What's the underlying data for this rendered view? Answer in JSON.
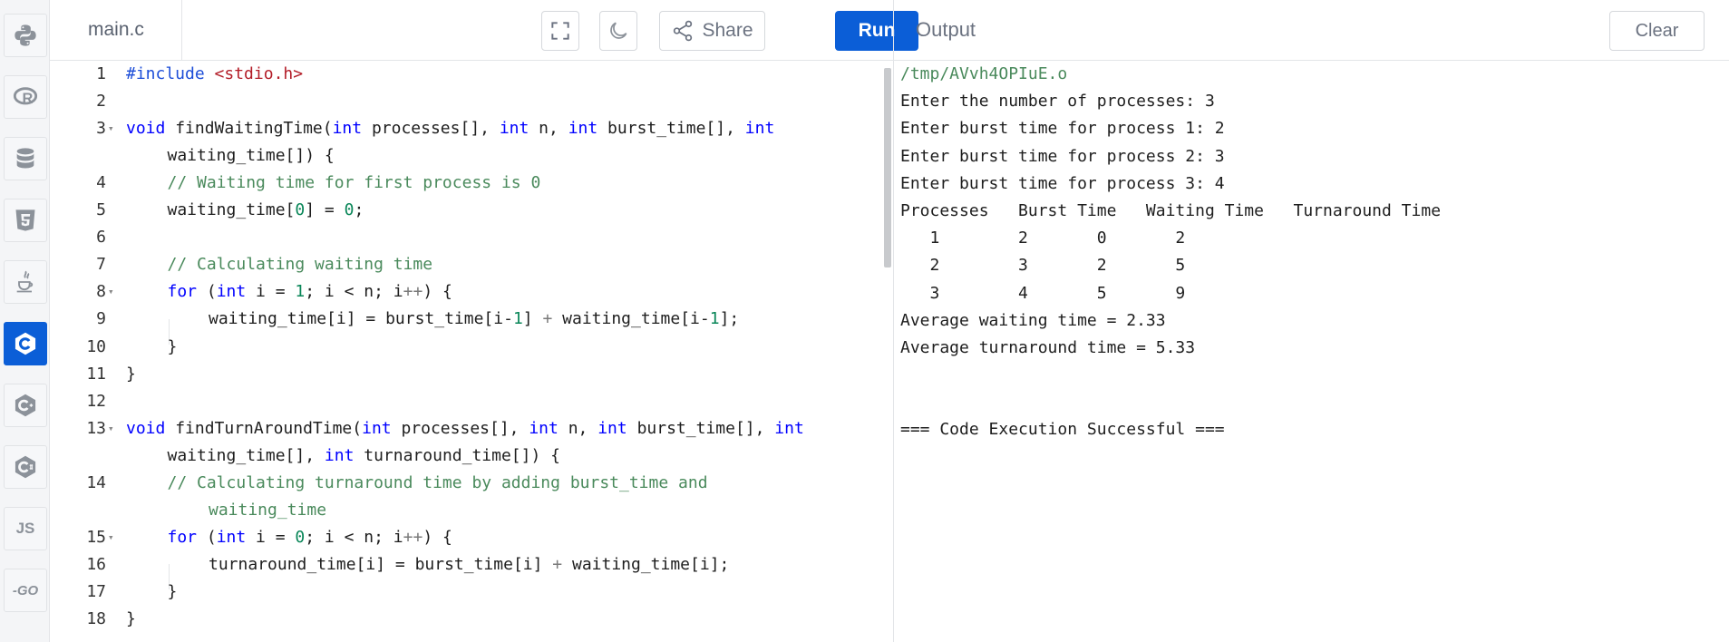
{
  "sidebar": {
    "languages": [
      {
        "name": "python-icon",
        "label": ""
      },
      {
        "name": "r-icon",
        "label": ""
      },
      {
        "name": "sql-icon",
        "label": ""
      },
      {
        "name": "html5-icon",
        "label": ""
      },
      {
        "name": "java-icon",
        "label": ""
      },
      {
        "name": "c-icon",
        "label": "",
        "active": true
      },
      {
        "name": "cpp-icon",
        "label": ""
      },
      {
        "name": "csharp-icon",
        "label": ""
      },
      {
        "name": "javascript-icon",
        "label": "JS"
      },
      {
        "name": "go-icon",
        "label": "-GO"
      }
    ]
  },
  "editor": {
    "filename": "main.c",
    "share_label": "Share",
    "run_label": "Run",
    "lines": [
      {
        "n": "1",
        "fold": false,
        "code": [
          [
            "pp",
            "#include "
          ],
          [
            "str",
            "<stdio.h>"
          ]
        ]
      },
      {
        "n": "2",
        "fold": false,
        "code": []
      },
      {
        "n": "3",
        "fold": true,
        "code": [
          [
            "kw",
            "void"
          ],
          [
            "",
            "  findWaitingTime("
          ],
          [
            "kw",
            "int"
          ],
          [
            "",
            " processes[], "
          ],
          [
            "kw",
            "int"
          ],
          [
            "",
            " n, "
          ],
          [
            "kw",
            "int"
          ],
          [
            "",
            " burst_time[], "
          ],
          [
            "kw",
            "int"
          ]
        ]
      },
      {
        "n": "",
        "fold": false,
        "indent": 1,
        "code": [
          [
            "",
            "waiting_time[]) {"
          ]
        ]
      },
      {
        "n": "4",
        "fold": false,
        "indent": 1,
        "code": [
          [
            "cm",
            "// Waiting time for first process is 0"
          ]
        ]
      },
      {
        "n": "5",
        "fold": false,
        "indent": 1,
        "code": [
          [
            "",
            "waiting_time["
          ],
          [
            "num",
            "0"
          ],
          [
            "",
            "] = "
          ],
          [
            "num",
            "0"
          ],
          [
            "",
            ";"
          ]
        ]
      },
      {
        "n": "6",
        "fold": false,
        "code": []
      },
      {
        "n": "7",
        "fold": false,
        "indent": 1,
        "code": [
          [
            "cm",
            "// Calculating waiting time"
          ]
        ]
      },
      {
        "n": "8",
        "fold": true,
        "indent": 1,
        "code": [
          [
            "kw",
            "for"
          ],
          [
            "",
            " ("
          ],
          [
            "kw",
            "int"
          ],
          [
            "",
            " i = "
          ],
          [
            "num",
            "1"
          ],
          [
            "",
            "; i < n; i"
          ],
          [
            "op",
            "++"
          ],
          [
            "",
            ") {"
          ]
        ]
      },
      {
        "n": "9",
        "fold": false,
        "indent": 2,
        "code": [
          [
            "",
            "waiting_time[i] = burst_time[i-"
          ],
          [
            "num",
            "1"
          ],
          [
            "",
            "] "
          ],
          [
            "op",
            "+"
          ],
          [
            "",
            " waiting_time[i-"
          ],
          [
            "num",
            "1"
          ],
          [
            "",
            "];"
          ]
        ]
      },
      {
        "n": "10",
        "fold": false,
        "indent": 1,
        "code": [
          [
            "",
            "}"
          ]
        ]
      },
      {
        "n": "11",
        "fold": false,
        "code": [
          [
            "",
            "}"
          ]
        ]
      },
      {
        "n": "12",
        "fold": false,
        "code": []
      },
      {
        "n": "13",
        "fold": true,
        "code": [
          [
            "kw",
            "void"
          ],
          [
            "",
            "  findTurnAroundTime("
          ],
          [
            "kw",
            "int"
          ],
          [
            "",
            " processes[], "
          ],
          [
            "kw",
            "int"
          ],
          [
            "",
            " n, "
          ],
          [
            "kw",
            "int"
          ],
          [
            "",
            " burst_time[], "
          ],
          [
            "kw",
            "int"
          ]
        ]
      },
      {
        "n": "",
        "fold": false,
        "indent": 1,
        "code": [
          [
            "",
            "waiting_time[], "
          ],
          [
            "kw",
            "int"
          ],
          [
            "",
            " turnaround_time[]) {"
          ]
        ]
      },
      {
        "n": "14",
        "fold": false,
        "indent": 1,
        "code": [
          [
            "cm",
            "// Calculating turnaround time by adding burst_time and"
          ]
        ]
      },
      {
        "n": "",
        "fold": false,
        "indent": 2,
        "code": [
          [
            "cm",
            "waiting_time"
          ]
        ]
      },
      {
        "n": "15",
        "fold": true,
        "indent": 1,
        "code": [
          [
            "kw",
            "for"
          ],
          [
            "",
            " ("
          ],
          [
            "kw",
            "int"
          ],
          [
            "",
            " i = "
          ],
          [
            "num",
            "0"
          ],
          [
            "",
            "; i < n; i"
          ],
          [
            "op",
            "++"
          ],
          [
            "",
            ") {"
          ]
        ]
      },
      {
        "n": "16",
        "fold": false,
        "indent": 2,
        "code": [
          [
            "",
            "turnaround_time[i] = burst_time[i] "
          ],
          [
            "op",
            "+"
          ],
          [
            "",
            " waiting_time[i];"
          ]
        ]
      },
      {
        "n": "17",
        "fold": false,
        "indent": 1,
        "code": [
          [
            "",
            "}"
          ]
        ]
      },
      {
        "n": "18",
        "fold": false,
        "code": [
          [
            "",
            "}"
          ]
        ]
      }
    ]
  },
  "output": {
    "title": "Output",
    "clear_label": "Clear",
    "lines": [
      {
        "text": "/tmp/AVvh4OPIuE.o",
        "path": true
      },
      {
        "text": "Enter the number of processes: 3"
      },
      {
        "text": "Enter burst time for process 1: 2"
      },
      {
        "text": "Enter burst time for process 2: 3"
      },
      {
        "text": "Enter burst time for process 3: 4"
      },
      {
        "text": "Processes   Burst Time   Waiting Time   Turnaround Time"
      },
      {
        "text": "   1        2       0       2"
      },
      {
        "text": "   2        3       2       5"
      },
      {
        "text": "   3        4       5       9"
      },
      {
        "text": "Average waiting time = 2.33"
      },
      {
        "text": "Average turnaround time = 5.33"
      },
      {
        "text": ""
      },
      {
        "text": ""
      },
      {
        "text": "=== Code Execution Successful ==="
      }
    ]
  }
}
